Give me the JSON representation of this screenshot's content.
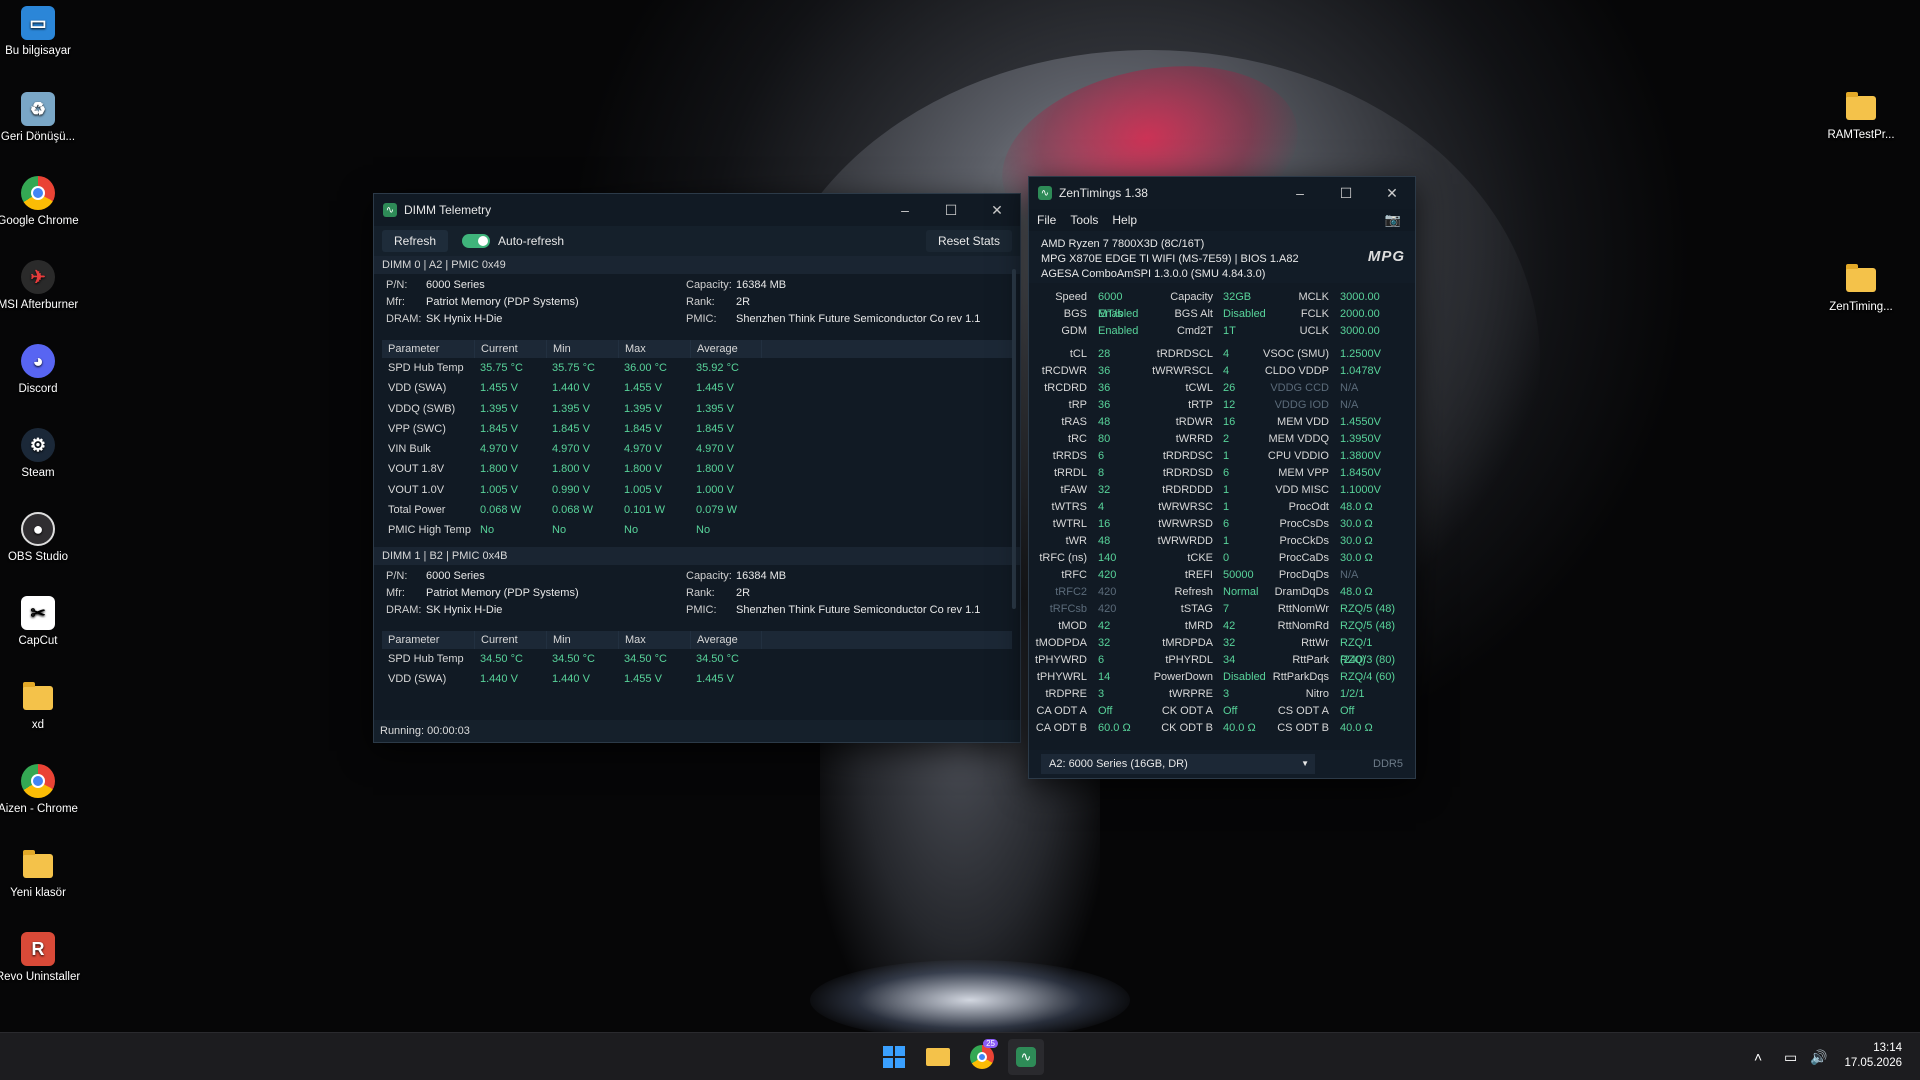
{
  "desktop_icons": [
    {
      "label": "Bu bilgisayar",
      "icon": "monitor-icon"
    },
    {
      "label": "Geri Dönüşü...",
      "icon": "recycle-bin-icon"
    },
    {
      "label": "Google Chrome",
      "icon": "chrome-icon"
    },
    {
      "label": "MSI Afterburner",
      "icon": "afterburner-icon"
    },
    {
      "label": "Discord",
      "icon": "discord-icon"
    },
    {
      "label": "Steam",
      "icon": "steam-icon"
    },
    {
      "label": "OBS Studio",
      "icon": "obs-icon"
    },
    {
      "label": "CapCut",
      "icon": "capcut-icon"
    },
    {
      "label": "xd",
      "icon": "folder-icon"
    },
    {
      "label": "Aizen - Chrome",
      "icon": "chrome-icon"
    },
    {
      "label": "Yeni klasör",
      "icon": "folder-icon"
    },
    {
      "label": "Revo Uninstaller",
      "icon": "revo-icon"
    },
    {
      "label": "RAMTestPr...",
      "icon": "folder-icon"
    },
    {
      "label": "ZenTiming...",
      "icon": "folder-icon"
    }
  ],
  "dimm_window": {
    "title": "DIMM Telemetry",
    "refresh_label": "Refresh",
    "auto_refresh_label": "Auto-refresh",
    "reset_label": "Reset Stats",
    "status": "Running: 00:00:03",
    "headers": [
      "Parameter",
      "Current",
      "Min",
      "Max",
      "Average"
    ],
    "dimm0": {
      "title": "DIMM 0 | A2 | PMIC 0x49",
      "pn_k": "P/N:",
      "pn": "6000 Series",
      "mfr_k": "Mfr:",
      "mfr": "Patriot Memory (PDP Systems)",
      "dram_k": "DRAM:",
      "dram": "SK Hynix H-Die",
      "cap_k": "Capacity:",
      "cap": "16384 MB",
      "rank_k": "Rank:",
      "rank": "2R",
      "pmic_k": "PMIC:",
      "pmic": "Shenzhen Think Future Semiconductor Co rev 1.1",
      "rows": [
        [
          "SPD Hub Temp",
          "35.75 °C",
          "35.75 °C",
          "36.00 °C",
          "35.92 °C"
        ],
        [
          "VDD (SWA)",
          "1.455 V",
          "1.440 V",
          "1.455 V",
          "1.445 V"
        ],
        [
          "VDDQ (SWB)",
          "1.395 V",
          "1.395 V",
          "1.395 V",
          "1.395 V"
        ],
        [
          "VPP (SWC)",
          "1.845 V",
          "1.845 V",
          "1.845 V",
          "1.845 V"
        ],
        [
          "VIN Bulk",
          "4.970 V",
          "4.970 V",
          "4.970 V",
          "4.970 V"
        ],
        [
          "VOUT 1.8V",
          "1.800 V",
          "1.800 V",
          "1.800 V",
          "1.800 V"
        ],
        [
          "VOUT 1.0V",
          "1.005 V",
          "0.990 V",
          "1.005 V",
          "1.000 V"
        ],
        [
          "Total Power",
          "0.068 W",
          "0.068 W",
          "0.101 W",
          "0.079 W"
        ],
        [
          "PMIC High Temp",
          "No",
          "No",
          "No",
          "No"
        ]
      ]
    },
    "dimm1": {
      "title": "DIMM 1 | B2 | PMIC 0x4B",
      "pn_k": "P/N:",
      "pn": "6000 Series",
      "mfr_k": "Mfr:",
      "mfr": "Patriot Memory (PDP Systems)",
      "dram_k": "DRAM:",
      "dram": "SK Hynix H-Die",
      "cap_k": "Capacity:",
      "cap": "16384 MB",
      "rank_k": "Rank:",
      "rank": "2R",
      "pmic_k": "PMIC:",
      "pmic": "Shenzhen Think Future Semiconductor Co rev 1.1",
      "rows": [
        [
          "SPD Hub Temp",
          "34.50 °C",
          "34.50 °C",
          "34.50 °C",
          "34.50 °C"
        ],
        [
          "VDD (SWA)",
          "1.440 V",
          "1.440 V",
          "1.455 V",
          "1.445 V"
        ]
      ]
    }
  },
  "zen_window": {
    "title": "ZenTimings 1.38",
    "menu": [
      "File",
      "Tools",
      "Help"
    ],
    "cpu": "AMD Ryzen 7 7800X3D (8C/16T)",
    "board": "MPG X870E EDGE TI WIFI (MS-7E59) | BIOS 1.A82",
    "agesa": "AGESA ComboAmSPI 1.3.0.0 (SMU 4.84.3.0)",
    "logo": "MPG",
    "grid_top": [
      [
        "Speed",
        "6000 MT/s",
        "Capacity",
        "32GB",
        "MCLK",
        "3000.00"
      ],
      [
        "BGS",
        "Enabled",
        "BGS Alt",
        "Disabled",
        "FCLK",
        "2000.00"
      ],
      [
        "GDM",
        "Enabled",
        "Cmd2T",
        "1T",
        "UCLK",
        "3000.00"
      ]
    ],
    "grid_main": [
      [
        "tCL",
        "28",
        "tRDRDSCL",
        "4",
        "VSOC (SMU)",
        "1.2500V"
      ],
      [
        "tRCDWR",
        "36",
        "tWRWRSCL",
        "4",
        "CLDO VDDP",
        "1.0478V"
      ],
      [
        "tRCDRD",
        "36",
        "tCWL",
        "26",
        "VDDG CCD",
        "N/A"
      ],
      [
        "tRP",
        "36",
        "tRTP",
        "12",
        "VDDG IOD",
        "N/A"
      ],
      [
        "tRAS",
        "48",
        "tRDWR",
        "16",
        "MEM VDD",
        "1.4550V"
      ],
      [
        "tRC",
        "80",
        "tWRRD",
        "2",
        "MEM VDDQ",
        "1.3950V"
      ],
      [
        "tRRDS",
        "6",
        "tRDRDSC",
        "1",
        "CPU VDDIO",
        "1.3800V"
      ],
      [
        "tRRDL",
        "8",
        "tRDRDSD",
        "6",
        "MEM VPP",
        "1.8450V"
      ],
      [
        "tFAW",
        "32",
        "tRDRDDD",
        "1",
        "VDD MISC",
        "1.1000V"
      ],
      [
        "tWTRS",
        "4",
        "tWRWRSC",
        "1",
        "ProcOdt",
        "48.0 Ω"
      ],
      [
        "tWTRL",
        "16",
        "tWRWRSD",
        "6",
        "ProcCsDs",
        "30.0 Ω"
      ],
      [
        "tWR",
        "48",
        "tWRWRDD",
        "1",
        "ProcCkDs",
        "30.0 Ω"
      ],
      [
        "tRFC (ns)",
        "140",
        "tCKE",
        "0",
        "ProcCaDs",
        "30.0 Ω"
      ],
      [
        "tRFC",
        "420",
        "tREFI",
        "50000",
        "ProcDqDs",
        "N/A"
      ],
      [
        "tRFC2",
        "420",
        "Refresh",
        "Normal",
        "DramDqDs",
        "48.0 Ω"
      ],
      [
        "tRFCsb",
        "420",
        "tSTAG",
        "7",
        "RttNomWr",
        "RZQ/5 (48)"
      ],
      [
        "tMOD",
        "42",
        "tMRD",
        "42",
        "RttNomRd",
        "RZQ/5 (48)"
      ],
      [
        "tMODPDA",
        "32",
        "tMRDPDA",
        "32",
        "RttWr",
        "RZQ/1 (240)"
      ],
      [
        "tPHYWRD",
        "6",
        "tPHYRDL",
        "34",
        "RttPark",
        "RZQ/3 (80)"
      ],
      [
        "tPHYWRL",
        "14",
        "PowerDown",
        "Disabled",
        "RttParkDqs",
        "RZQ/4 (60)"
      ],
      [
        "tRDPRE",
        "3",
        "tWRPRE",
        "3",
        "Nitro",
        "1/2/1"
      ],
      [
        "CA ODT A",
        "Off",
        "CK ODT A",
        "Off",
        "CS ODT A",
        "Off"
      ],
      [
        "CA ODT B",
        "60.0 Ω",
        "CK ODT B",
        "40.0 Ω",
        "CS ODT B",
        "40.0 Ω"
      ]
    ],
    "dimm_select": "A2: 6000 Series (16GB, DR)",
    "ddr_label": "DDR5"
  },
  "taskbar": {
    "time": "13:14",
    "date": "17.05.2026",
    "badge": "25"
  }
}
